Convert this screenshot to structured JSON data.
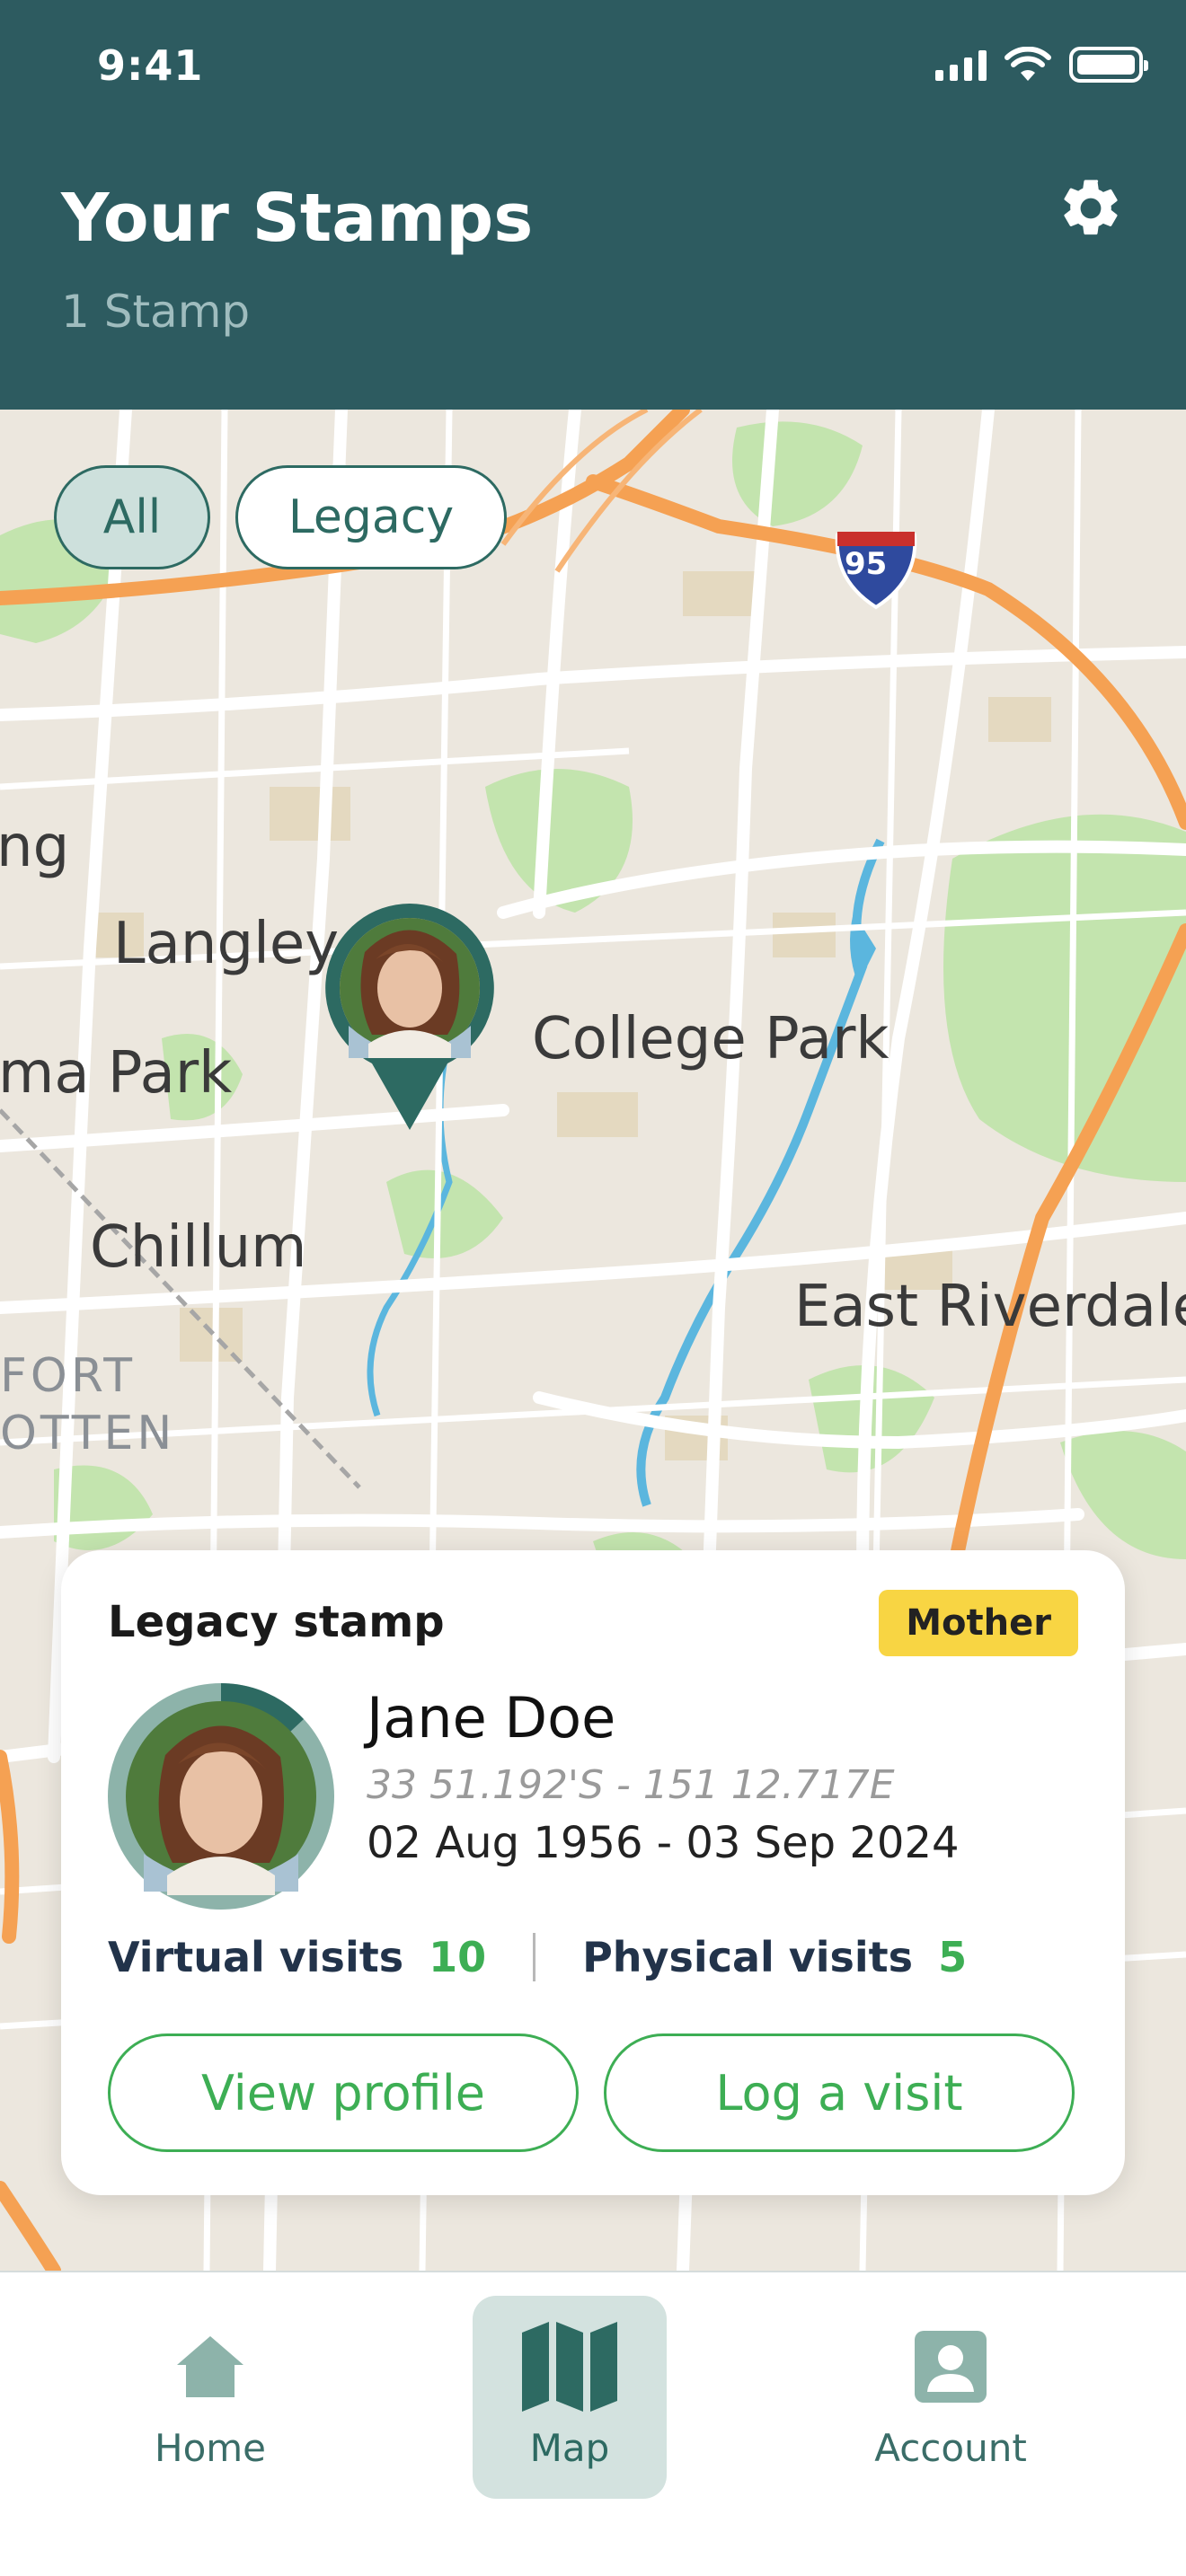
{
  "status_bar": {
    "time": "9:41"
  },
  "header": {
    "title": "Your Stamps",
    "subtitle": "1 Stamp",
    "settings_icon": "gear-icon"
  },
  "filters": [
    {
      "label": "All",
      "selected": true
    },
    {
      "label": "Legacy",
      "selected": false
    }
  ],
  "map_labels": [
    "ng",
    "Langley",
    "College Park",
    "ma Park",
    "Chillum",
    "East Riverdale",
    "FORT",
    "OTTEN",
    "95"
  ],
  "stamp_card": {
    "type_label": "Legacy stamp",
    "relation_badge": "Mother",
    "name": "Jane Doe",
    "coordinates": "33 51.192'S - 151 12.717E",
    "dates": "02 Aug 1956 - 03 Sep 2024",
    "virtual_visits_label": "Virtual visits",
    "virtual_visits_count": "10",
    "physical_visits_label": "Physical visits",
    "physical_visits_count": "5",
    "view_profile_label": "View profile",
    "log_visit_label": "Log a visit"
  },
  "bottom_nav": {
    "home": "Home",
    "map": "Map",
    "account": "Account",
    "active": "Map"
  },
  "colors": {
    "header": "#2d5b60",
    "accent_green": "#3dae54",
    "badge_yellow": "#f8d543",
    "teal": "#2d6a62"
  }
}
